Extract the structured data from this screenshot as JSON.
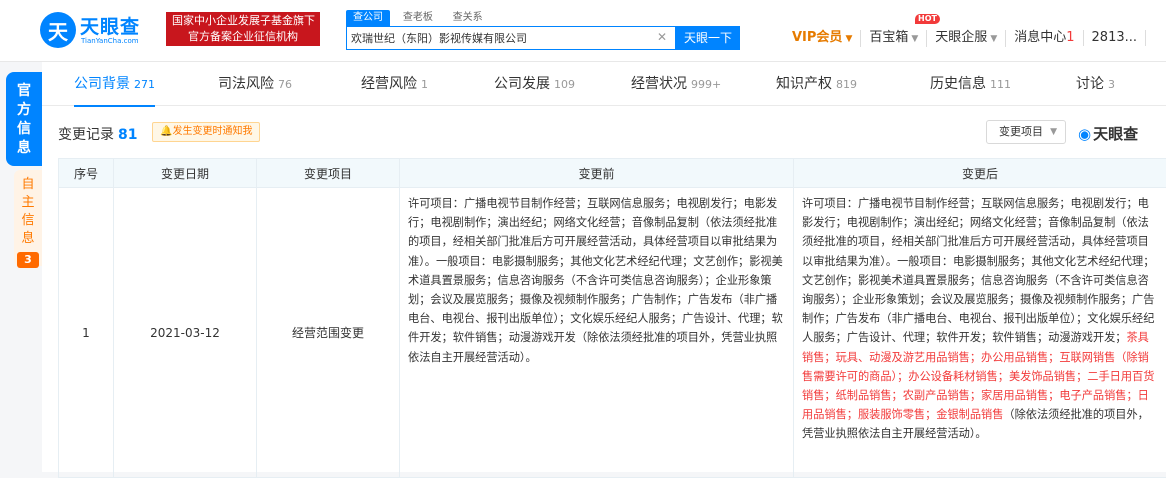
{
  "header": {
    "logo_glyph": "天",
    "logo_name": "天眼查",
    "logo_sub": "TianYanCha.com",
    "gov_badge_line1": "国家中小企业发展子基金旗下",
    "gov_badge_line2": "官方备案企业征信机构",
    "search_tabs": [
      "查公司",
      "查老板",
      "查关系"
    ],
    "search_value": "欢瑞世纪（东阳）影视传媒有限公司",
    "search_button": "天眼一下",
    "nav": {
      "vip": "VIP会员",
      "treasure": "百宝箱",
      "hot": "HOT",
      "enterprise": "天眼企服",
      "messages": "消息中心",
      "message_count": "1",
      "user": "2813..."
    }
  },
  "side": {
    "official": "官方信息",
    "self": "自主信息",
    "self_count": "3"
  },
  "tabs": [
    {
      "label": "公司背景",
      "count": "271"
    },
    {
      "label": "司法风险",
      "count": "76"
    },
    {
      "label": "经营风险",
      "count": "1"
    },
    {
      "label": "公司发展",
      "count": "109"
    },
    {
      "label": "经营状况",
      "count": "999+"
    },
    {
      "label": "知识产权",
      "count": "819"
    },
    {
      "label": "历史信息",
      "count": "111"
    },
    {
      "label": "讨论",
      "count": "3"
    }
  ],
  "section": {
    "title": "变更记录",
    "count": "81",
    "notify_button": "发生变更时通知我",
    "filter_label": "变更项目",
    "watermark": "天眼查"
  },
  "table": {
    "headers": [
      "序号",
      "变更日期",
      "变更项目",
      "变更前",
      "变更后"
    ],
    "rows": [
      {
        "index": "1",
        "date": "2021-03-12",
        "item": "经营范围变更",
        "before": "许可项目：广播电视节目制作经营；互联网信息服务；电视剧发行；电影发行；电视剧制作；演出经纪；网络文化经营；音像制品复制（依法须经批准的项目，经相关部门批准后方可开展经营活动，具体经营项目以审批结果为准）。一般项目：电影摄制服务；其他文化艺术经纪代理；文艺创作；影视美术道具置景服务；信息咨询服务（不含许可类信息咨询服务）；企业形象策划；会议及展览服务；摄像及视频制作服务；广告制作；广告发布（非广播电台、电视台、报刊出版单位）；文化娱乐经纪人服务；广告设计、代理；软件开发；软件销售；动漫游戏开发（除依法须经批准的项目外，凭营业执照依法自主开展经营活动）。",
        "after_plain_1": "许可项目：广播电视节目制作经营；互联网信息服务；电视剧发行；电影发行；电视剧制作；演出经纪；网络文化经营；音像制品复制（依法须经批准的项目，经相关部门批准后方可开展经营活动，具体经营项目以审批结果为准）。一般项目：电影摄制服务；其他文化艺术经纪代理；文艺创作；影视美术道具置景服务；信息咨询服务（不含许可类信息咨询服务）；企业形象策划；会议及展览服务；摄像及视频制作服务；广告制作；广告发布（非广播电台、电视台、报刊出版单位）；文化娱乐经纪人服务；广告设计、代理；软件开发；软件销售；动漫游戏开发；",
        "after_highlight": "茶具销售；玩具、动漫及游艺用品销售；办公用品销售；互联网销售（除销售需要许可的商品）；办公设备耗材销售；美发饰品销售；二手日用百货销售；纸制品销售；农副产品销售；家居用品销售；电子产品销售；日用品销售；服装服饰零售；金银制品销售",
        "after_plain_2": "（除依法须经批准的项目外，凭营业执照依法自主开展经营活动）。"
      }
    ]
  }
}
